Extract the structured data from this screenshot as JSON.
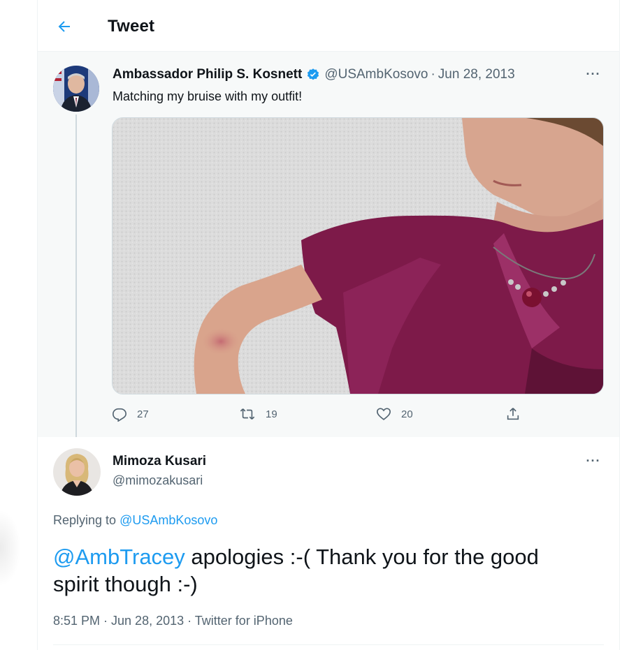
{
  "header": {
    "title": "Tweet",
    "back_icon": "arrow-left-icon"
  },
  "original_tweet": {
    "author_name": "Ambassador Philip S. Kosnett",
    "verified": true,
    "handle": "@USAmbKosovo",
    "separator": "·",
    "date": "Jun 28, 2013",
    "text": "Matching my bruise with my outfit!",
    "more_label": "···",
    "actions": {
      "replies": "27",
      "retweets": "19",
      "likes": "20"
    }
  },
  "reply_tweet": {
    "author_name": "Mimoza Kusari",
    "handle": "@mimozakusari",
    "more_label": "···",
    "replying_prefix": "Replying to",
    "replying_to": "@USAmbKosovo",
    "mention": "@AmbTracey",
    "text": " apologies :-( Thank you for the good spirit though :-)",
    "meta_time": "8:51 PM · Jun 28, 2013 · ",
    "meta_source": "Twitter for iPhone"
  },
  "colors": {
    "accent": "#1d9bf0",
    "secondary_text": "#536471",
    "quoted_bg": "#f7f9f9"
  }
}
